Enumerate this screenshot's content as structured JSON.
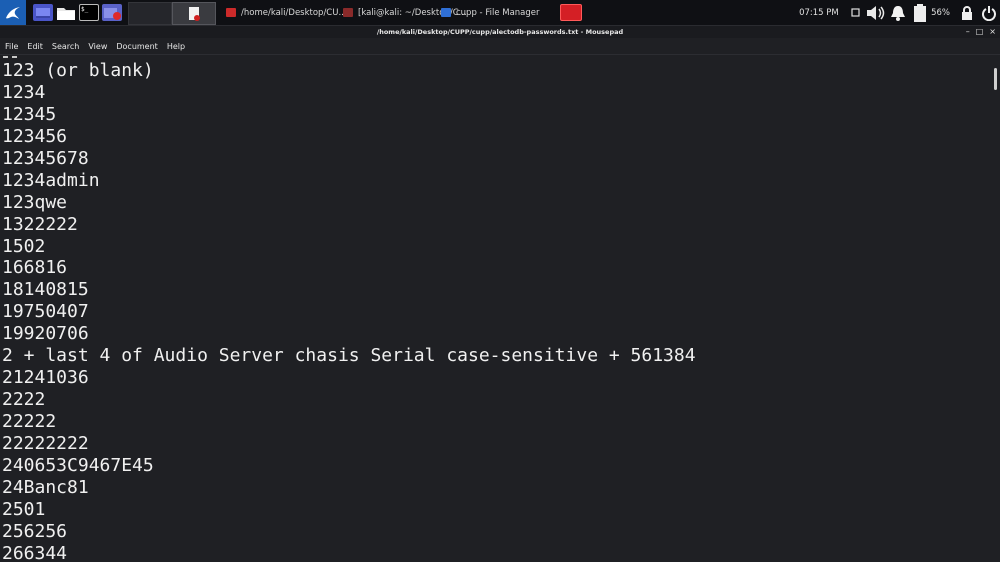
{
  "panel": {
    "launcher_icons": [
      "desktop-icon",
      "file-manager-icon",
      "terminal-icon",
      "screen-recorder-icon"
    ],
    "terminal_prompt": "$_",
    "tasks": [
      {
        "label": "/home/kali/Desktop/CU...",
        "icon": "mousepad-icon",
        "color": "#cc2a2a"
      },
      {
        "label": "[kali@kali: ~/Desktop/C...",
        "icon": "terminal-icon",
        "color": "#8a2a2a"
      },
      {
        "label": "cupp - File Manager",
        "icon": "folder-icon",
        "color": "#2f6fd6"
      }
    ],
    "clock": "07:15 PM",
    "battery": "56%",
    "tray_icons": [
      "notification-icon",
      "volume-icon",
      "bell-icon",
      "battery-icon",
      "lock-icon",
      "power-icon"
    ]
  },
  "window": {
    "title": "/home/kali/Desktop/CUPP/cupp/alectodb-passwords.txt - Mousepad",
    "controls": [
      "minimize",
      "maximize",
      "close"
    ]
  },
  "menu": [
    "File",
    "Edit",
    "Search",
    "View",
    "Document",
    "Help"
  ],
  "editor": {
    "lines": [
      "123 (or blank)",
      "1234",
      "12345",
      "123456",
      "12345678",
      "1234admin",
      "123qwe",
      "1322222",
      "1502",
      "166816",
      "18140815",
      "19750407",
      "19920706",
      "2 + last 4 of Audio Server chasis Serial case-sensitive + 561384",
      "21241036",
      "2222",
      "22222",
      "22222222",
      "240653C9467E45",
      "24Banc81",
      "2501",
      "256256",
      "266344"
    ]
  },
  "colors": {
    "panel_bg": "#0f1014",
    "editor_bg": "#1f2024",
    "text": "#f0f0f0",
    "kali_blue": "#1b5fb4",
    "red_app": "#d41f25"
  }
}
